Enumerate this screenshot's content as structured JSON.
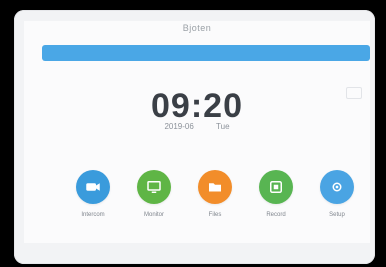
{
  "header": {
    "brand": "Bjoten"
  },
  "clock": {
    "time": "09:20",
    "date": "2019-06",
    "day": "Tue"
  },
  "apps": [
    {
      "name": "Intercom",
      "icon": "video-icon",
      "color": "#3a9bdc"
    },
    {
      "name": "Monitor",
      "icon": "monitor-icon",
      "color": "#5fb545"
    },
    {
      "name": "Files",
      "icon": "folder-icon",
      "color": "#f28d2a"
    },
    {
      "name": "Record",
      "icon": "record-icon",
      "color": "#58b552"
    },
    {
      "name": "Setup",
      "icon": "settings-icon",
      "color": "#4aa4e3"
    }
  ]
}
